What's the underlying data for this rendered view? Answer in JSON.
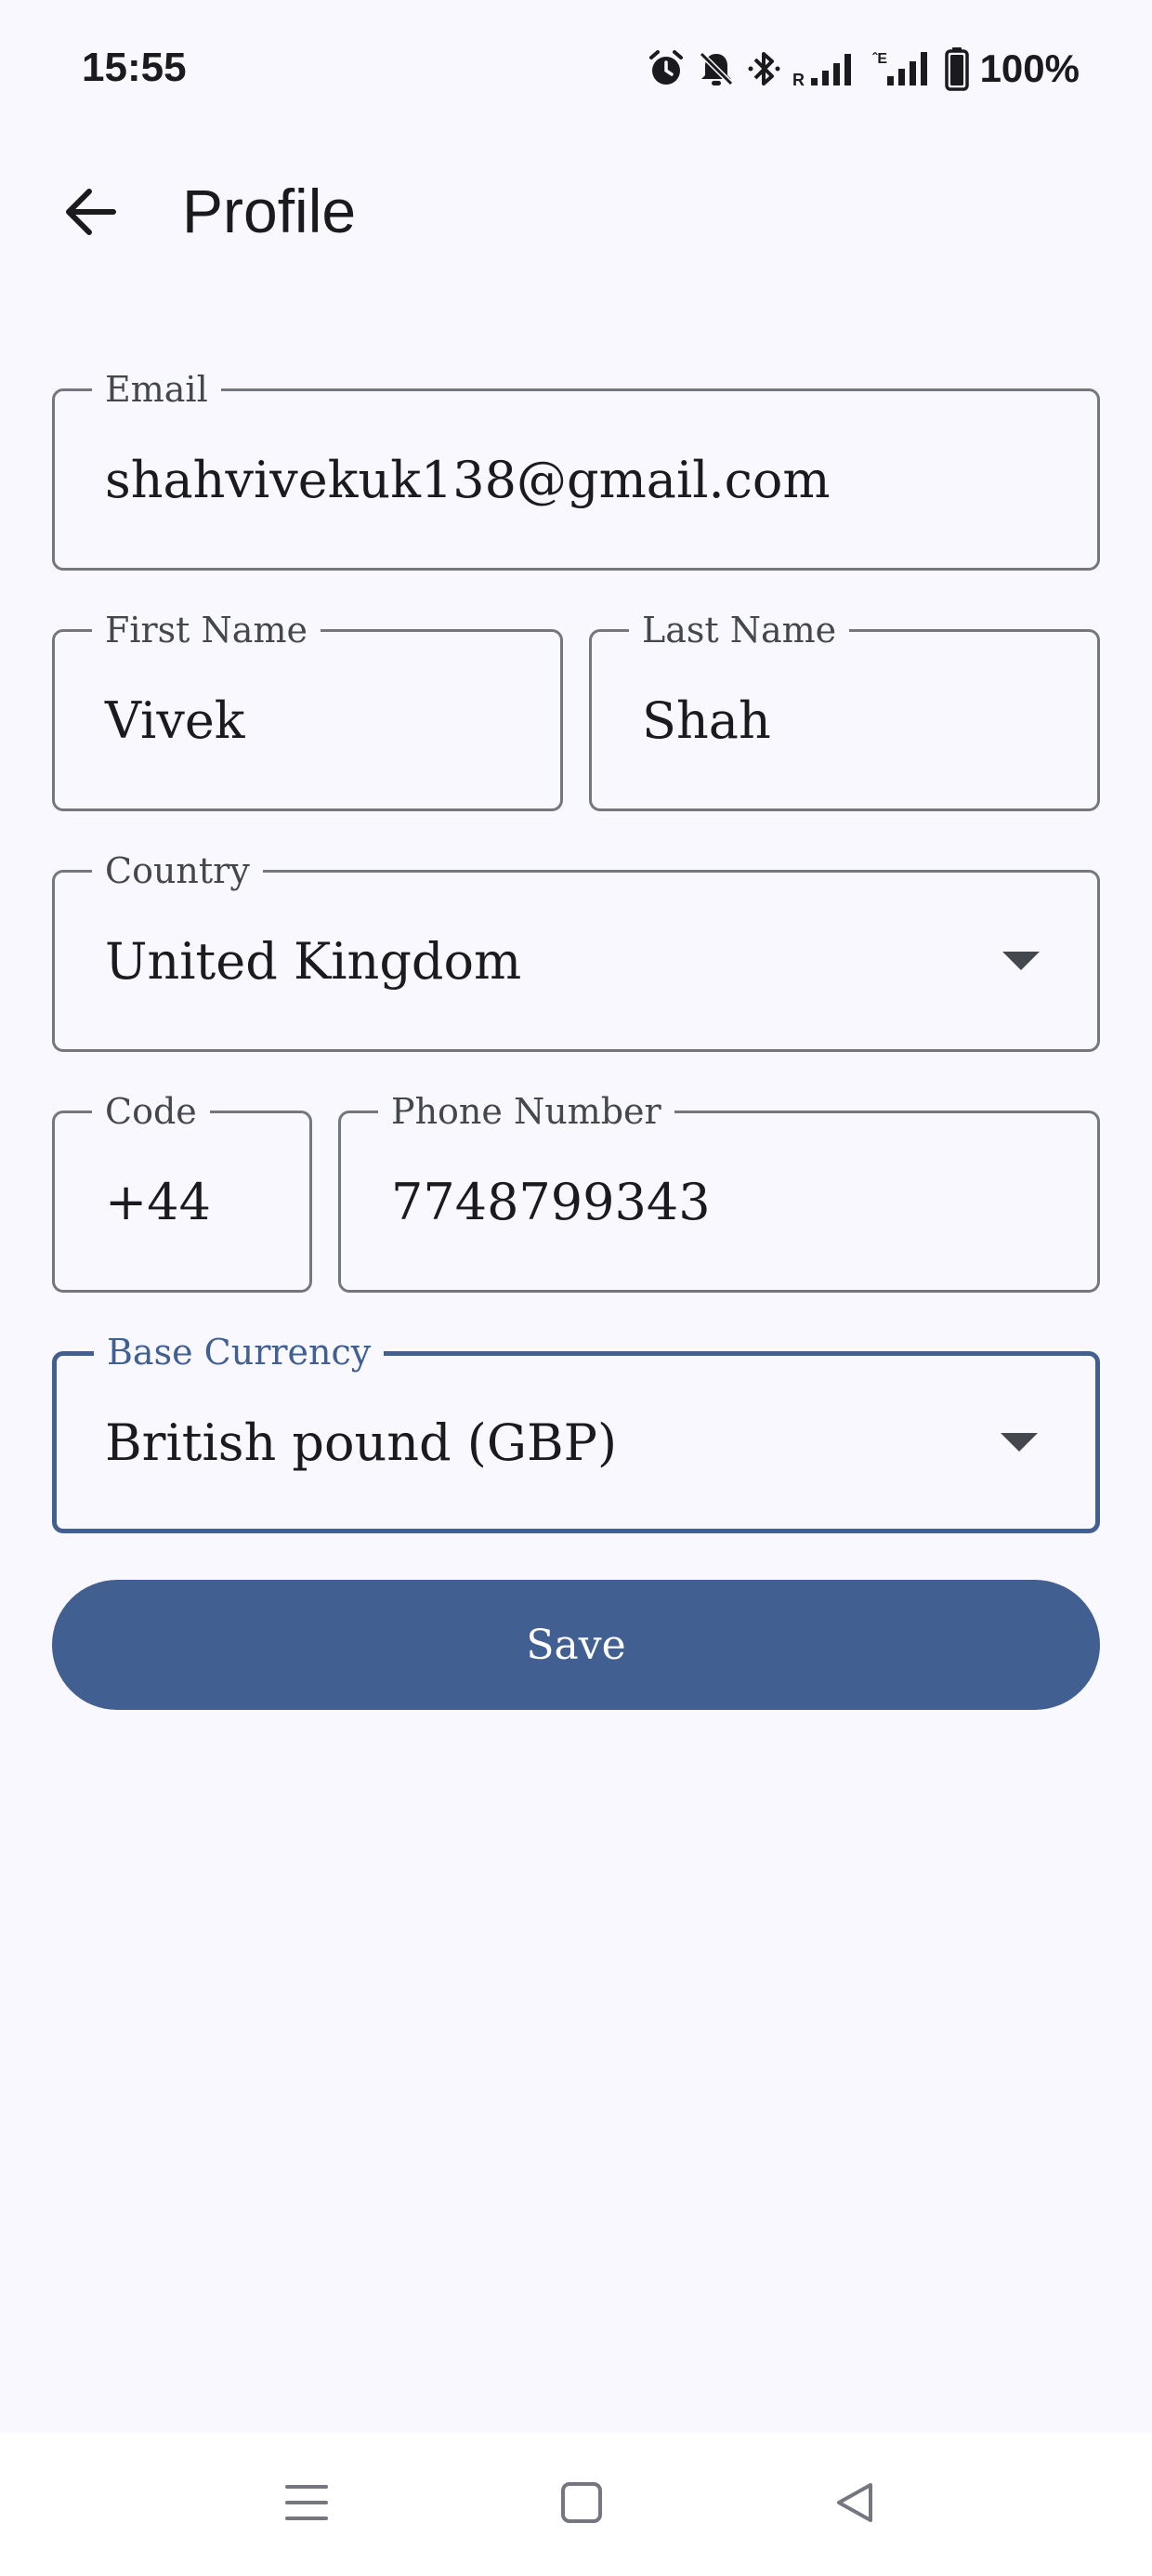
{
  "status_bar": {
    "time": "15:55",
    "battery": "100%",
    "icons": [
      "alarm-icon",
      "bell-off-icon",
      "bluetooth-icon",
      "signal-roaming-icon",
      "signal-icon",
      "battery-icon"
    ]
  },
  "app_bar": {
    "title": "Profile",
    "back_icon": "arrow-back-icon"
  },
  "form": {
    "email": {
      "label": "Email",
      "value": "shahvivekuk138@gmail.com"
    },
    "first_name": {
      "label": "First Name",
      "value": "Vivek"
    },
    "last_name": {
      "label": "Last Name",
      "value": "Shah"
    },
    "country": {
      "label": "Country",
      "value": "United Kingdom"
    },
    "code": {
      "label": "Code",
      "value": "+44"
    },
    "phone": {
      "label": "Phone Number",
      "value": "7748799343"
    },
    "base_currency": {
      "label": "Base Currency",
      "value": "British pound (GBP)",
      "focused": true
    }
  },
  "actions": {
    "save_label": "Save"
  },
  "nav_bar": {
    "buttons": [
      "recents-menu-icon",
      "home-square-icon",
      "back-triangle-icon"
    ]
  },
  "colors": {
    "primary": "#415f91",
    "background": "#f8f8fe",
    "outline": "#74777f",
    "on_surface": "#1b1b1f"
  }
}
